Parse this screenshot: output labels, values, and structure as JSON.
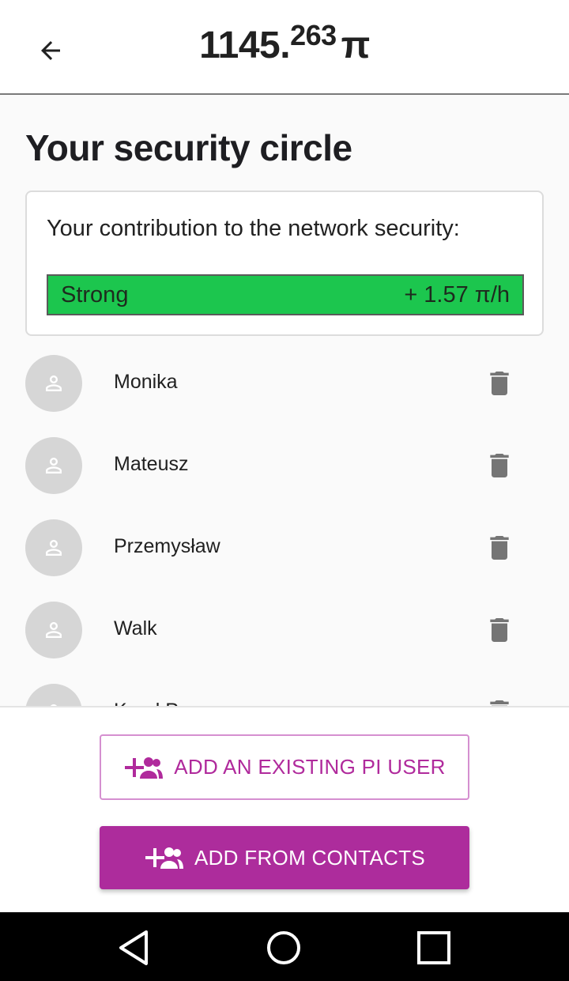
{
  "header": {
    "balance_int": "1145.",
    "balance_dec": "263",
    "currency": "π"
  },
  "page": {
    "title": "Your security circle"
  },
  "security_card": {
    "label": "Your contribution to the network security:",
    "strength": "Strong",
    "rate": "+ 1.57 π/h",
    "bar_color": "#1cc64e"
  },
  "members": [
    {
      "name": "Monika"
    },
    {
      "name": "Mateusz"
    },
    {
      "name": "Przemysław"
    },
    {
      "name": "Walk"
    },
    {
      "name": "Karol P"
    }
  ],
  "actions": {
    "add_existing": "ADD AN EXISTING PI USER",
    "add_contacts": "ADD FROM CONTACTS",
    "accent_color": "#ad2c9c"
  },
  "icons": {
    "back": "arrow-left-icon",
    "avatar": "person-outline-icon",
    "delete": "trash-icon",
    "add_people": "group-add-icon",
    "nav_back": "triangle-back-icon",
    "nav_home": "circle-home-icon",
    "nav_recent": "square-recent-icon"
  }
}
